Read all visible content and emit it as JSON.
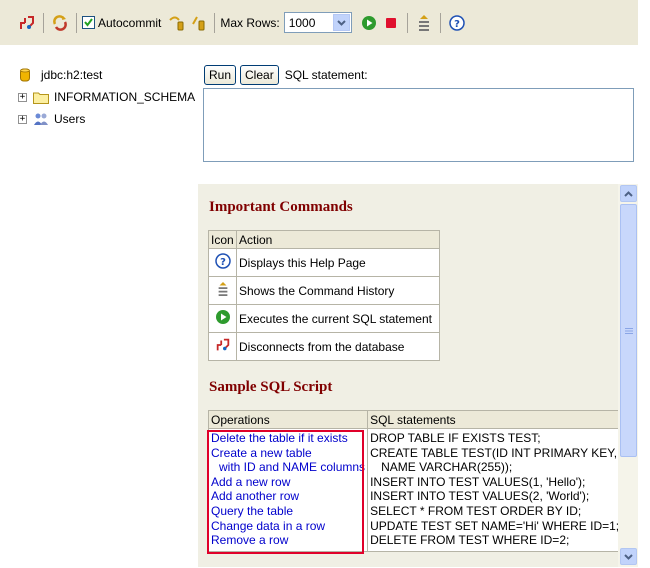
{
  "toolbar": {
    "autocommit_label": "Autocommit",
    "autocommit_checked": true,
    "max_rows_label": "Max Rows:",
    "max_rows_value": "1000",
    "icons": [
      "disconnect-icon",
      "refresh-icon",
      "commit-icon",
      "rollback-icon",
      "run-icon",
      "stop-icon",
      "history-icon",
      "help-icon"
    ]
  },
  "tree": {
    "connection": "jdbc:h2:test",
    "nodes": [
      {
        "label": "INFORMATION_SCHEMA",
        "icon": "folder-icon"
      },
      {
        "label": "Users",
        "icon": "users-icon"
      }
    ]
  },
  "query": {
    "run_label": "Run",
    "clear_label": "Clear",
    "sql_label": "SQL statement:",
    "sql_value": ""
  },
  "help": {
    "important_title": "Important Commands",
    "commands_header": {
      "icon": "Icon",
      "action": "Action"
    },
    "commands": [
      {
        "icon": "help-icon",
        "action": "Displays this Help Page"
      },
      {
        "icon": "history-icon",
        "action": "Shows the Command History"
      },
      {
        "icon": "run-icon",
        "action": "Executes the current SQL statement"
      },
      {
        "icon": "disconnect-icon",
        "action": "Disconnects from the database"
      }
    ],
    "sample_title": "Sample SQL Script",
    "sample_header": {
      "operations": "Operations",
      "statements": "SQL statements"
    },
    "operations": [
      "Delete the table if it exists",
      "Create a new table",
      "with ID and NAME columns",
      "Add a new row",
      "Add another row",
      "Query the table",
      "Change data in a row",
      "Remove a row"
    ],
    "statements": [
      "DROP TABLE IF EXISTS TEST;",
      "CREATE TABLE TEST(ID INT PRIMARY KEY,",
      "NAME VARCHAR(255));",
      "INSERT INTO TEST VALUES(1, 'Hello');",
      "INSERT INTO TEST VALUES(2, 'World');",
      "SELECT * FROM TEST ORDER BY ID;",
      "UPDATE TEST SET NAME='Hi' WHERE ID=1;",
      "DELETE FROM TEST WHERE ID=2;"
    ],
    "highlight_color": "#e0002a",
    "link_color": "#0000cc",
    "heading_color": "#800000"
  }
}
